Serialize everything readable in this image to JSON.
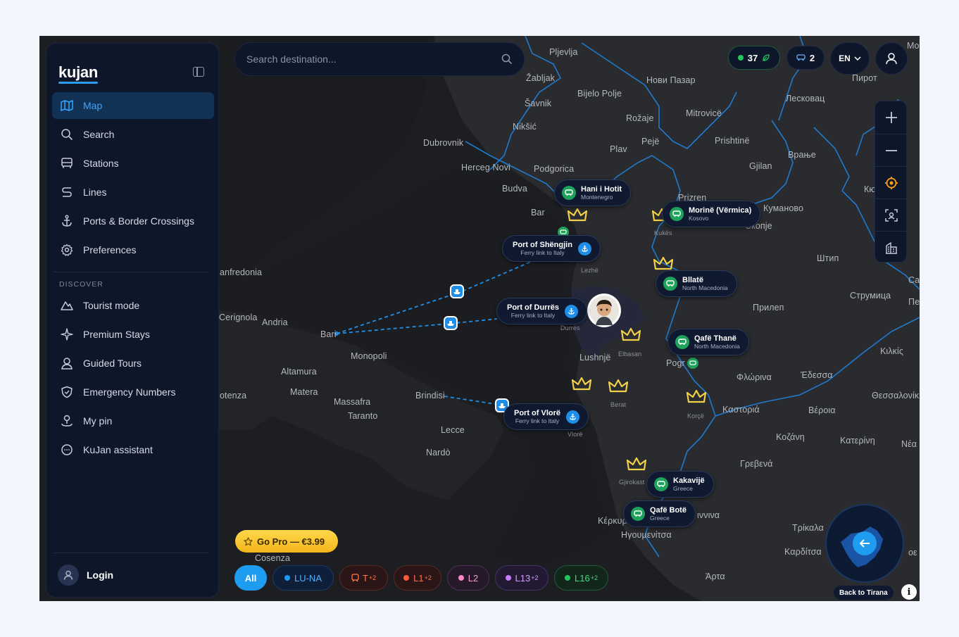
{
  "brand": {
    "logo": "kujan"
  },
  "sidebar": {
    "nav": [
      {
        "label": "Map",
        "icon": "map-icon",
        "active": true
      },
      {
        "label": "Search",
        "icon": "search-icon"
      },
      {
        "label": "Stations",
        "icon": "bus-icon"
      },
      {
        "label": "Lines",
        "icon": "route-icon"
      },
      {
        "label": "Ports & Border Crossings",
        "icon": "anchor-icon"
      },
      {
        "label": "Preferences",
        "icon": "gear-icon"
      }
    ],
    "discover_title": "DISCOVER",
    "discover": [
      {
        "label": "Tourist mode",
        "icon": "mountain-icon"
      },
      {
        "label": "Premium Stays",
        "icon": "sparkle-icon"
      },
      {
        "label": "Guided Tours",
        "icon": "guide-icon"
      },
      {
        "label": "Emergency Numbers",
        "icon": "shield-icon"
      },
      {
        "label": "My pin",
        "icon": "pin-icon"
      },
      {
        "label": "KuJan assistant",
        "icon": "chat-icon"
      }
    ],
    "login_label": "Login"
  },
  "search": {
    "placeholder": "Search destination..."
  },
  "topbar": {
    "active_count": "37",
    "bus_count": "2",
    "language": "EN"
  },
  "map_labels": [
    "Pljevlja",
    "Žabljak",
    "Нови Пазар",
    "Пирот",
    "Bijelo Polje",
    "Лесковац",
    "Šavnik",
    "Rožaje",
    "Mitrovicë",
    "Nikšić",
    "Pejë",
    "Prishtinë",
    "Dubrovnik",
    "Plav",
    "Врање",
    "Herceg Novi",
    "Podgorica",
    "Gjilan",
    "Budva",
    "Prizren",
    "Кюсте",
    "Bar",
    "Куманово",
    "Kukës",
    "Lezhë",
    "Скопје",
    "Штип",
    "anfredonia",
    "Струмица",
    "Прилеп",
    "Cerignola",
    "Andria",
    "Bari",
    "Durrës",
    "Elbasan",
    "Lushnjë",
    "Pogr",
    "Altamura",
    "Monopoli",
    "Φλώρινα",
    "Έδεσσα",
    "Κιλκίς",
    "otenza",
    "Matera",
    "Massafra",
    "Brindisi",
    "Taranto",
    "Berat",
    "Korçë",
    "Καστοριά",
    "Βέροια",
    "Θεσσαλονίκ",
    "Lecce",
    "Vlorë",
    "Κοζάνη",
    "Κατερίνη",
    "Nardò",
    "Γρεβενά",
    "Νέα",
    "Gjirokast",
    "Κέρκυρα",
    "Ηγουμενίτσα",
    "ιννινα",
    "Τρίκαλα",
    "Καρδίτσα",
    "Cosenza",
    "Άρτα",
    "Mo",
    "Ca",
    "Пе",
    "οε"
  ],
  "stations": [
    {
      "name": "Hani i Hotit",
      "country": "Montenegro"
    },
    {
      "name": "Morinë (Vërmica)",
      "country": "Kosovo"
    },
    {
      "name": "Bllatë",
      "country": "North Macedonia"
    },
    {
      "name": "Qafë Thanë",
      "country": "North Macedonia"
    },
    {
      "name": "Kakavijë",
      "country": "Greece"
    },
    {
      "name": "Qafë Botë",
      "country": "Greece"
    }
  ],
  "ports": [
    {
      "name": "Port of Shëngjin",
      "sub": "Ferry link to Italy"
    },
    {
      "name": "Port of Durrës",
      "sub": "Ferry link to Italy"
    },
    {
      "name": "Port of Vlorë",
      "sub": "Ferry link to Italy"
    }
  ],
  "gopro_label": "Go Pro — €3.99",
  "filters": [
    {
      "label": "All",
      "color": "#1e9cf0"
    },
    {
      "label": "LU-NA",
      "color": "#1e9cf0"
    },
    {
      "label": "T",
      "extra": "+2",
      "color": "#ff6b3d"
    },
    {
      "label": "L1",
      "extra": "+2",
      "color": "#ff5a3c"
    },
    {
      "label": "L2",
      "color": "#ff86c8"
    },
    {
      "label": "L13",
      "extra": "+2",
      "color": "#c77dff"
    },
    {
      "label": "L16",
      "extra": "+2",
      "color": "#22c55e"
    }
  ],
  "back_label": "Back to Tirana",
  "info_label": "i",
  "colors": {
    "accent": "#1e9cf0",
    "border_line": "#1f7fd6",
    "station": "#1fa35c",
    "crown": "#f2d14a"
  }
}
